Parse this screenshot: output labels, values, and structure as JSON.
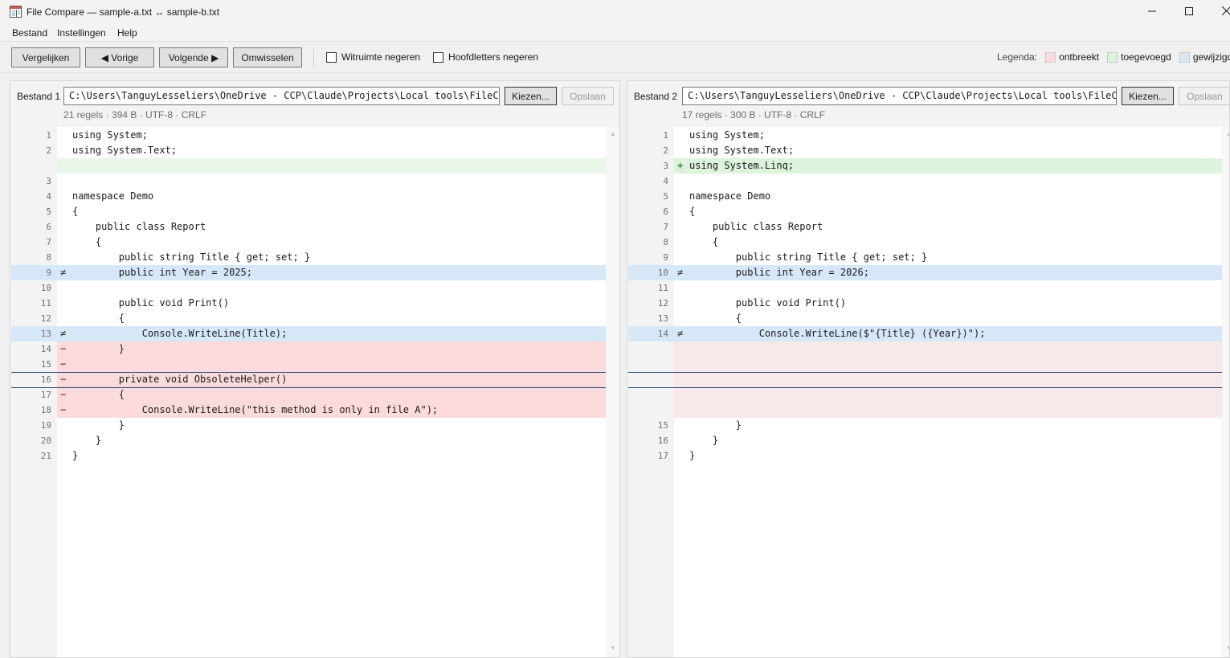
{
  "window": {
    "title": "File Compare — sample-a.txt ↔ sample-b.txt",
    "icon": "app-compare-icon"
  },
  "menu": {
    "bestand": "Bestand",
    "instellingen": "Instellingen",
    "help": "Help"
  },
  "toolbar": {
    "compare_label": "Vergelijken",
    "prev_label": "◀ Vorige",
    "next_label": "Volgende ▶",
    "swap_label": "Omwisselen",
    "ignore_whitespace_label": "Witruimte negeren",
    "ignore_whitespace_checked": false,
    "ignore_case_label": "Hoofdletters negeren",
    "ignore_case_checked": false,
    "legend_title": "Legenda:",
    "legend": [
      {
        "label": "ontbreekt",
        "color": "#fadada"
      },
      {
        "label": "toegevoegd",
        "color": "#dcf3dc"
      },
      {
        "label": "gewijzigd",
        "color": "#d6e8f8"
      }
    ]
  },
  "pane_a": {
    "label": "Bestand 1",
    "path": "C:\\Users\\TanguyLesseliers\\OneDrive - CCP\\Claude\\Projects\\Local tools\\FileCompare\\sample-a.txt",
    "pick_label": "Kiezen...",
    "save_label": "Opslaan",
    "info": "21 regels · 394 B · UTF-8 · CRLF",
    "rows": [
      {
        "ln": "1",
        "mark": "",
        "code": "using System;",
        "kind": "equal"
      },
      {
        "ln": "2",
        "mark": "",
        "code": "using System.Text;",
        "kind": "equal"
      },
      {
        "ln": "",
        "mark": "",
        "code": "",
        "kind": "placeholder-added"
      },
      {
        "ln": "3",
        "mark": "",
        "code": "",
        "kind": "equal"
      },
      {
        "ln": "4",
        "mark": "",
        "code": "namespace Demo",
        "kind": "equal"
      },
      {
        "ln": "5",
        "mark": "",
        "code": "{",
        "kind": "equal"
      },
      {
        "ln": "6",
        "mark": "",
        "code": "    public class Report",
        "kind": "equal"
      },
      {
        "ln": "7",
        "mark": "",
        "code": "    {",
        "kind": "equal"
      },
      {
        "ln": "8",
        "mark": "",
        "code": "        public string Title { get; set; }",
        "kind": "equal"
      },
      {
        "ln": "9",
        "mark": "≠",
        "code": "        public int Year = 2025;",
        "kind": "modified"
      },
      {
        "ln": "10",
        "mark": "",
        "code": "",
        "kind": "equal"
      },
      {
        "ln": "11",
        "mark": "",
        "code": "        public void Print()",
        "kind": "equal"
      },
      {
        "ln": "12",
        "mark": "",
        "code": "        {",
        "kind": "equal"
      },
      {
        "ln": "13",
        "mark": "≠",
        "code": "            Console.WriteLine(Title);",
        "kind": "modified"
      },
      {
        "ln": "14",
        "mark": "−",
        "code": "        }",
        "kind": "deleted"
      },
      {
        "ln": "15",
        "mark": "−",
        "code": "",
        "kind": "deleted"
      },
      {
        "ln": "16",
        "mark": "−",
        "code": "        private void ObsoleteHelper()",
        "kind": "deleted"
      },
      {
        "ln": "17",
        "mark": "−",
        "code": "        {",
        "kind": "deleted"
      },
      {
        "ln": "18",
        "mark": "−",
        "code": "            Console.WriteLine(\"this method is only in file A\");",
        "kind": "deleted"
      },
      {
        "ln": "19",
        "mark": "",
        "code": "        }",
        "kind": "equal"
      },
      {
        "ln": "20",
        "mark": "",
        "code": "    }",
        "kind": "equal"
      },
      {
        "ln": "21",
        "mark": "",
        "code": "}",
        "kind": "equal"
      }
    ]
  },
  "pane_b": {
    "label": "Bestand 2",
    "path": "C:\\Users\\TanguyLesseliers\\OneDrive - CCP\\Claude\\Projects\\Local tools\\FileCompare\\sample-b.txt",
    "pick_label": "Kiezen...",
    "save_label": "Opslaan",
    "info": "17 regels · 300 B · UTF-8 · CRLF",
    "rows": [
      {
        "ln": "1",
        "mark": "",
        "code": "using System;",
        "kind": "equal"
      },
      {
        "ln": "2",
        "mark": "",
        "code": "using System.Text;",
        "kind": "equal"
      },
      {
        "ln": "3",
        "mark": "+",
        "code": "using System.Linq;",
        "kind": "added"
      },
      {
        "ln": "4",
        "mark": "",
        "code": "",
        "kind": "equal"
      },
      {
        "ln": "5",
        "mark": "",
        "code": "namespace Demo",
        "kind": "equal"
      },
      {
        "ln": "6",
        "mark": "",
        "code": "{",
        "kind": "equal"
      },
      {
        "ln": "7",
        "mark": "",
        "code": "    public class Report",
        "kind": "equal"
      },
      {
        "ln": "8",
        "mark": "",
        "code": "    {",
        "kind": "equal"
      },
      {
        "ln": "9",
        "mark": "",
        "code": "        public string Title { get; set; }",
        "kind": "equal"
      },
      {
        "ln": "10",
        "mark": "≠",
        "code": "        public int Year = 2026;",
        "kind": "modified"
      },
      {
        "ln": "11",
        "mark": "",
        "code": "",
        "kind": "equal"
      },
      {
        "ln": "12",
        "mark": "",
        "code": "        public void Print()",
        "kind": "equal"
      },
      {
        "ln": "13",
        "mark": "",
        "code": "        {",
        "kind": "equal"
      },
      {
        "ln": "14",
        "mark": "≠",
        "code": "            Console.WriteLine($\"{Title} ({Year})\");",
        "kind": "modified"
      },
      {
        "ln": "",
        "mark": "",
        "code": "",
        "kind": "placeholder-deleted"
      },
      {
        "ln": "",
        "mark": "",
        "code": "",
        "kind": "placeholder-deleted"
      },
      {
        "ln": "",
        "mark": "",
        "code": "",
        "kind": "placeholder-deleted"
      },
      {
        "ln": "",
        "mark": "",
        "code": "",
        "kind": "placeholder-deleted"
      },
      {
        "ln": "",
        "mark": "",
        "code": "",
        "kind": "placeholder-deleted"
      },
      {
        "ln": "15",
        "mark": "",
        "code": "        }",
        "kind": "equal"
      },
      {
        "ln": "16",
        "mark": "",
        "code": "    }",
        "kind": "equal"
      },
      {
        "ln": "17",
        "mark": "",
        "code": "}",
        "kind": "equal"
      }
    ]
  }
}
